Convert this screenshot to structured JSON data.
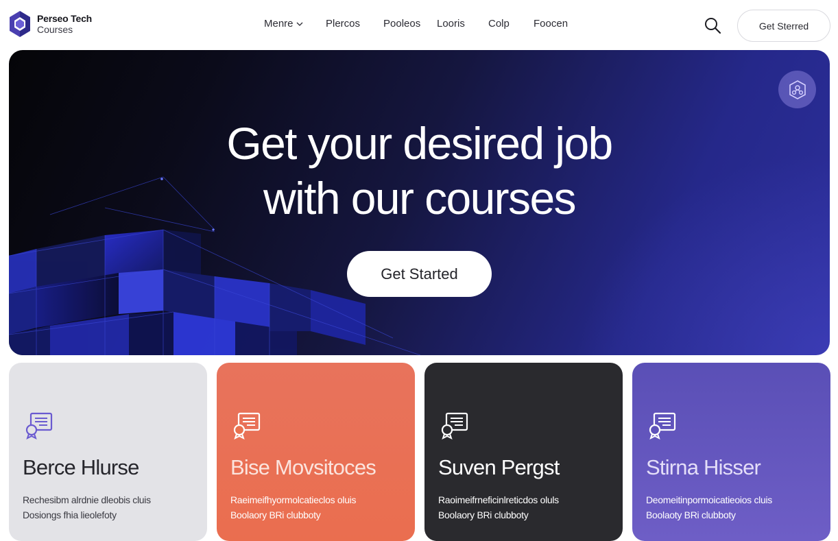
{
  "brand": {
    "name": "Perseo Tech",
    "subtitle": "Courses"
  },
  "nav": {
    "links": [
      {
        "label": "Menre",
        "has_dropdown": true
      },
      {
        "label": "Plercos"
      },
      {
        "label": "Pooleos"
      },
      {
        "label": "Looris"
      },
      {
        "label": "Colp"
      },
      {
        "label": "Foocen"
      }
    ],
    "search_icon": "search-icon",
    "cta_label": "Get Sterred"
  },
  "hero": {
    "title_line1": "Get your desired job",
    "title_line2": "with our courses",
    "cta_label": "Get Started",
    "badge_icon": "network-icon"
  },
  "cards": [
    {
      "title": "Berce Hlurse",
      "desc_line1": "Rechesibm alrdnie dleobis cluis",
      "desc_line2": "Dosiongs fhia lieolefoty",
      "icon": "course-certificate-icon",
      "color": "#e3e3e7"
    },
    {
      "title": "Bise Movsitoces",
      "desc_line1": "Raeimeifhyormolcatieclos oluis",
      "desc_line2": "Boolaory BRi clubboty",
      "icon": "course-certificate-icon",
      "color": "#ea6e4f"
    },
    {
      "title": "Suven Pergst",
      "desc_line1": "Raoimeifrneficinlreticdos oluls",
      "desc_line2": "Boolaory BRi clubboty",
      "icon": "course-certificate-icon",
      "color": "#2a2a2e"
    },
    {
      "title": "Stirna Hisser",
      "desc_line1": "Deomeitinpormoicatieoios cluis",
      "desc_line2": "Boolaoty BRi clubboty",
      "icon": "course-certificate-icon",
      "color": "#5a4fb6"
    }
  ],
  "colors": {
    "accent": "#2d2f9c",
    "hero_dark": "#050508"
  }
}
